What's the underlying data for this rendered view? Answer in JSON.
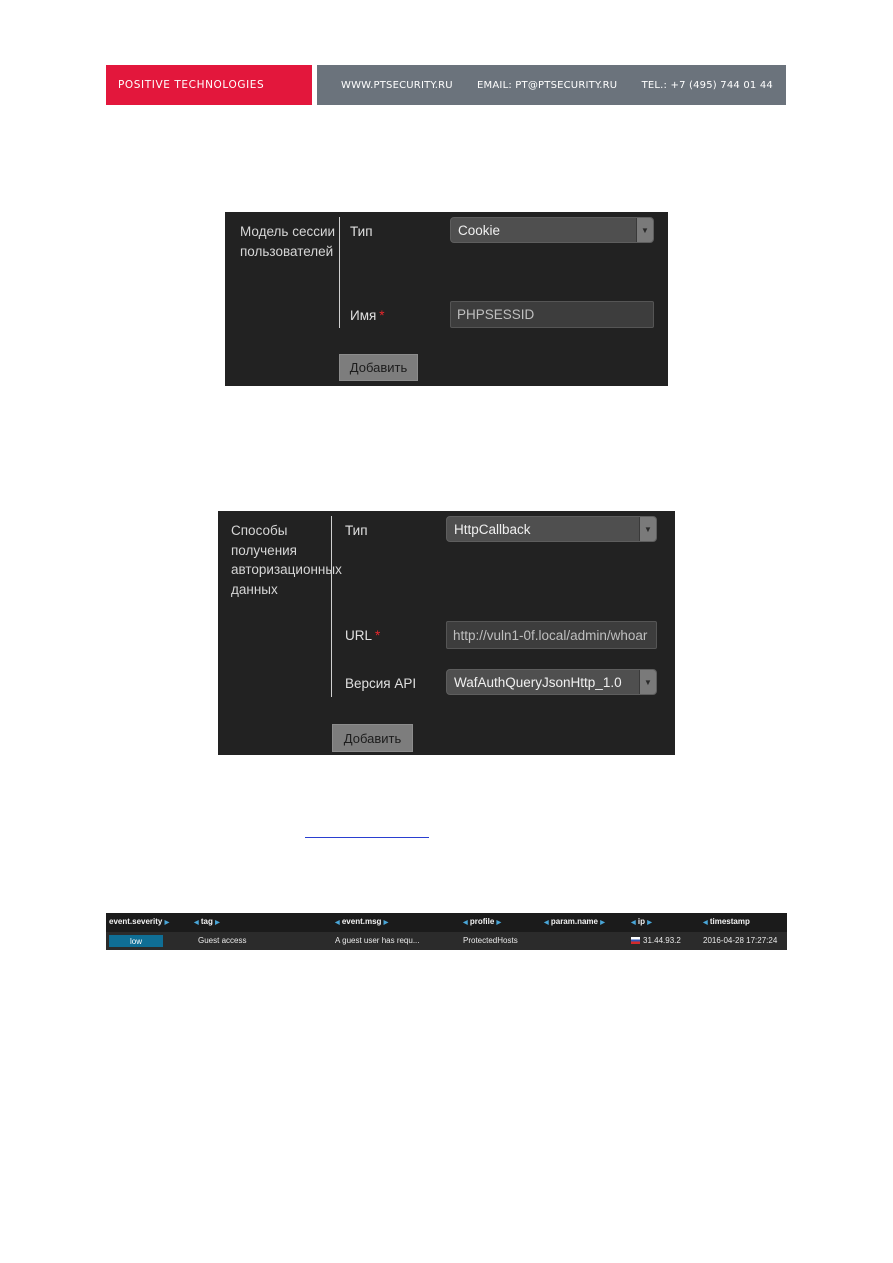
{
  "header": {
    "logo": "POSITIVE TECHNOLOGIES",
    "website": "WWW.PTSECURITY.RU",
    "email": "EMAIL: PT@PTSECURITY.RU",
    "phone": "TEL.: +7 (495) 744 01 44",
    "colors": {
      "brand_red": "#e3173c",
      "gray": "#6b737c"
    }
  },
  "session_panel": {
    "section_label": "Модель сессии пользователей",
    "type_label": "Тип",
    "type_value": "Cookie",
    "name_label": "Имя",
    "required_mark": "*",
    "name_value": "PHPSESSID",
    "add_button": "Добавить"
  },
  "auth_panel": {
    "section_label": "Способы получения авторизационных данных",
    "type_label": "Тип",
    "type_value": "HttpCallback",
    "url_label": "URL",
    "required_mark": "*",
    "url_value": "http://vuln1-0f.local/admin/whoar",
    "api_label": "Версия API",
    "api_value": "WafAuthQueryJsonHttp_1.0",
    "add_button": "Добавить"
  },
  "events_table": {
    "columns": [
      "event.severity",
      "tag",
      "event.msg",
      "profile",
      "param.name",
      "ip",
      "timestamp"
    ],
    "row": {
      "severity": "low",
      "tag": "Guest access",
      "msg": "A guest user has requ...",
      "profile": "ProtectedHosts",
      "param_name": "",
      "ip": "31.44.93.2",
      "timestamp": "2016-04-28 17:27:24"
    },
    "colors": {
      "severity_low": "#0f6e95",
      "sort_arrow": "#49a6d8"
    }
  }
}
